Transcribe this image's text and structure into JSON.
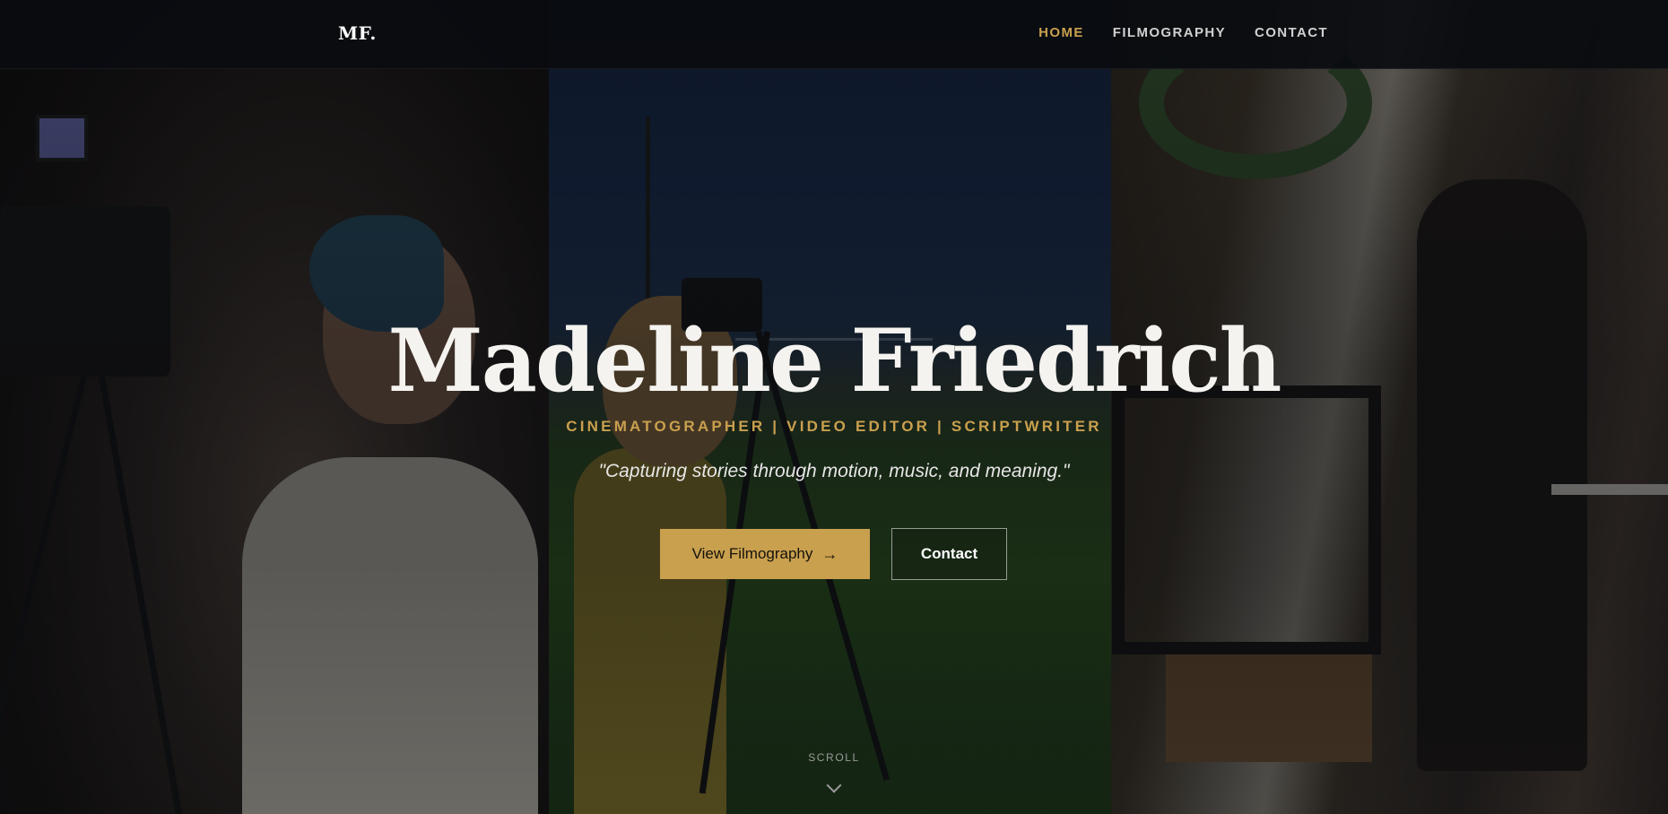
{
  "nav": {
    "logo": "MF.",
    "links": [
      {
        "label": "HOME",
        "active": true
      },
      {
        "label": "FILMOGRAPHY",
        "active": false
      },
      {
        "label": "CONTACT",
        "active": false
      }
    ]
  },
  "hero": {
    "title": "Madeline Friedrich",
    "roles": "CINEMATOGRAPHER | VIDEO EDITOR | SCRIPTWRITER",
    "tagline": "\"Capturing stories through motion, music, and meaning.\"",
    "primary_button": {
      "label": "View Filmography",
      "icon": "arrow-right-icon"
    },
    "secondary_button": {
      "label": "Contact"
    },
    "scroll_label": "SCROLL",
    "scroll_icon": "chevron-down-icon"
  },
  "colors": {
    "accent": "#c9a04e",
    "background": "#0b0d11",
    "text": "#f5f3ef"
  }
}
